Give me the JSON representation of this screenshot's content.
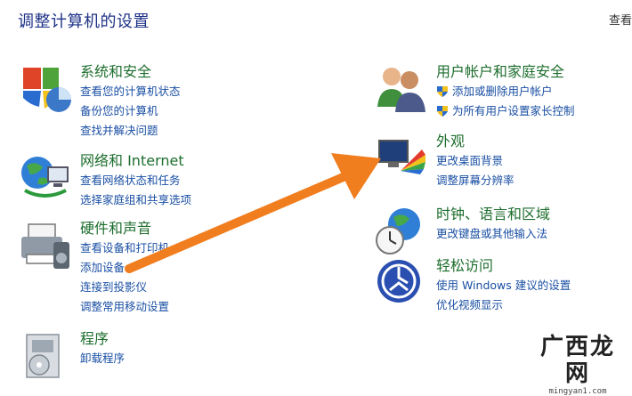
{
  "page": {
    "title": "调整计算机的设置",
    "view_by": "查看"
  },
  "categories_left": [
    {
      "title": "系统和安全",
      "icon": "shield-pie-icon",
      "links": [
        "查看您的计算机状态",
        "备份您的计算机",
        "查找并解决问题"
      ]
    },
    {
      "title": "网络和 Internet",
      "icon": "network-globe-icon",
      "links": [
        "查看网络状态和任务",
        "选择家庭组和共享选项"
      ]
    },
    {
      "title": "硬件和声音",
      "icon": "printer-icon",
      "links": [
        "查看设备和打印机",
        "添加设备",
        "连接到投影仪",
        "调整常用移动设置"
      ]
    },
    {
      "title": "程序",
      "icon": "programs-box-icon",
      "links": [
        "卸载程序"
      ]
    }
  ],
  "categories_right": [
    {
      "title": "用户帐户和家庭安全",
      "icon": "users-icon",
      "links": [
        "添加或删除用户帐户",
        "为所有用户设置家长控制"
      ]
    },
    {
      "title": "外观",
      "icon": "monitor-color-icon",
      "links": [
        "更改桌面背景",
        "调整屏幕分辨率"
      ]
    },
    {
      "title": "时钟、语言和区域",
      "icon": "clock-globe-icon",
      "links": [
        "更改键盘或其他输入法"
      ]
    },
    {
      "title": "轻松访问",
      "icon": "ease-of-access-icon",
      "links": [
        "使用 Windows 建议的设置",
        "优化视频显示"
      ]
    }
  ],
  "watermark": {
    "logo": "广西龙网",
    "url": "mingyan1.com"
  },
  "colors": {
    "title": "#1e3287",
    "category": "#1e6e2e",
    "link": "#1a4fa3",
    "arrow": "#f07d1e"
  }
}
